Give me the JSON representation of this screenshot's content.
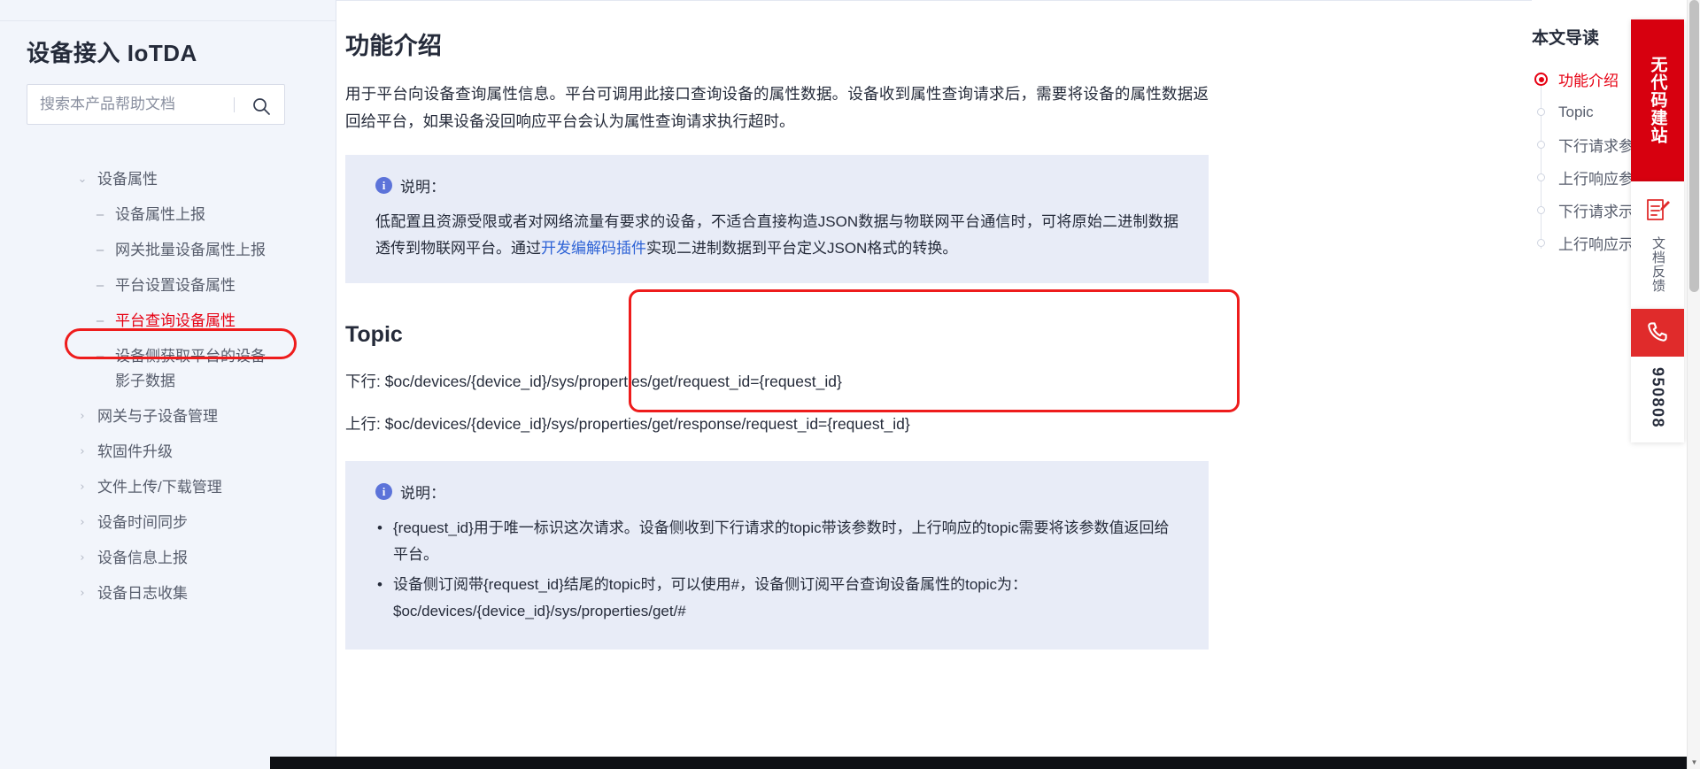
{
  "sidebar": {
    "product_title": "设备接入 IoTDA",
    "search": {
      "placeholder": "搜索本产品帮助文档",
      "value": "",
      "icon": "search-icon"
    },
    "nav": [
      {
        "label": "设备属性",
        "level": 1,
        "marker": "chevron-down-icon",
        "active": false
      },
      {
        "label": "设备属性上报",
        "level": 2,
        "marker": "dash",
        "active": false
      },
      {
        "label": "网关批量设备属性上报",
        "level": 2,
        "marker": "dash",
        "active": false
      },
      {
        "label": "平台设置设备属性",
        "level": 2,
        "marker": "dash",
        "active": false
      },
      {
        "label": "平台查询设备属性",
        "level": 2,
        "marker": "dash",
        "active": true
      },
      {
        "label": "设备侧获取平台的设备影子数据",
        "level": 2,
        "marker": "dash",
        "active": false
      },
      {
        "label": "网关与子设备管理",
        "level": 1,
        "marker": "chevron-right-icon",
        "active": false
      },
      {
        "label": "软固件升级",
        "level": 1,
        "marker": "chevron-right-icon",
        "active": false
      },
      {
        "label": "文件上传/下载管理",
        "level": 1,
        "marker": "chevron-right-icon",
        "active": false
      },
      {
        "label": "设备时间同步",
        "level": 1,
        "marker": "chevron-right-icon",
        "active": false
      },
      {
        "label": "设备信息上报",
        "level": 1,
        "marker": "chevron-right-icon",
        "active": false
      },
      {
        "label": "设备日志收集",
        "level": 1,
        "marker": "chevron-right-icon",
        "active": false
      }
    ]
  },
  "main": {
    "section_title": "功能介绍",
    "intro_paragraph": "用于平台向设备查询属性信息。平台可调用此接口查询设备的属性数据。设备收到属性查询请求后，需要将设备的属性数据返回给平台，如果设备没回响应平台会认为属性查询请求执行超时。",
    "note1": {
      "icon": "info-icon",
      "label": "说明：",
      "text_before_link": "低配置且资源受限或者对网络流量有要求的设备，不适合直接构造JSON数据与物联网平台通信时，可将原始二进制数据透传到物联网平台。通过",
      "link_text": "开发编解码插件",
      "text_after_link": "实现二进制数据到平台定义JSON格式的转换。"
    },
    "topic": {
      "title": "Topic",
      "downlink": "下行: $oc/devices/{device_id}/sys/properties/get/request_id={request_id}",
      "uplink": "上行: $oc/devices/{device_id}/sys/properties/get/response/request_id={request_id}"
    },
    "note2": {
      "icon": "info-icon",
      "label": "说明：",
      "bullets": [
        "{request_id}用于唯一标识这次请求。设备侧收到下行请求的topic带该参数时，上行响应的topic需要将该参数值返回给平台。",
        "设备侧订阅带{request_id}结尾的topic时，可以使用#，设备侧订阅平台查询设备属性的topic为：$oc/devices/{device_id}/sys/properties/get/#"
      ]
    }
  },
  "toc": {
    "title": "本文导读",
    "items": [
      {
        "label": "功能介绍",
        "active": true
      },
      {
        "label": "Topic",
        "active": false
      },
      {
        "label": "下行请求参数说明",
        "active": false
      },
      {
        "label": "上行响应参数说明",
        "active": false
      },
      {
        "label": "下行请求示例",
        "active": false
      },
      {
        "label": "上行响应示例",
        "active": false
      }
    ]
  },
  "float_bar": {
    "promo_label": "无代码建站",
    "feedback_label": "文档反馈",
    "feedback_icon": "edit-document-icon",
    "phone_icon": "phone-icon",
    "phone_number": "950808"
  },
  "colors": {
    "accent_red": "#e60012",
    "annotation_red": "#ee1c1c",
    "promo_red": "#d7000f",
    "link_blue": "#2e63d6",
    "note_bg": "#e8ecf7",
    "sidebar_bg": "#f2f5fb"
  }
}
